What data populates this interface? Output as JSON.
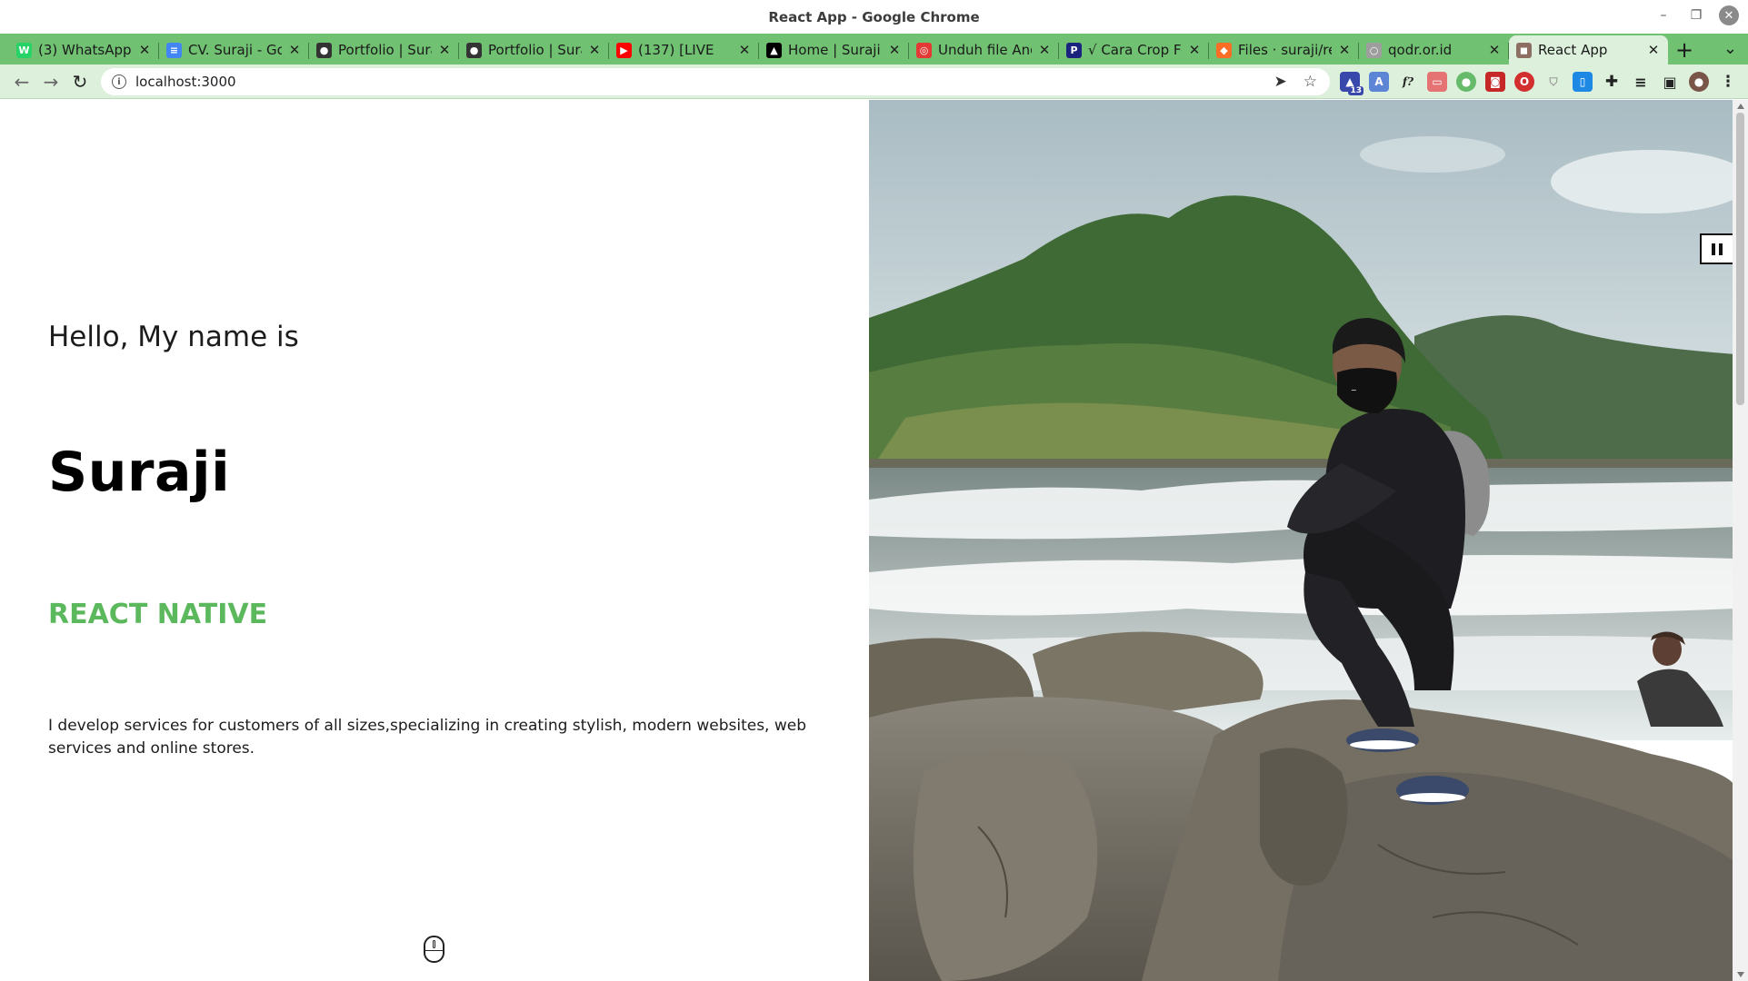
{
  "window": {
    "title": "React App - Google Chrome",
    "minimize_icon": "minimize-icon",
    "maximize_icon": "restore-icon",
    "close_icon": "close-icon"
  },
  "tabs": [
    {
      "label": "(3) WhatsApp",
      "icon": "whatsapp-icon",
      "color": "#25d366",
      "glyph": "W"
    },
    {
      "label": "CV. Suraji - Go",
      "icon": "google-docs-icon",
      "color": "#4285f4",
      "glyph": "≡"
    },
    {
      "label": "Portfolio | Sura",
      "icon": "github-icon",
      "color": "#333333",
      "glyph": "●"
    },
    {
      "label": "Portfolio | Sura",
      "icon": "github-icon",
      "color": "#333333",
      "glyph": "●"
    },
    {
      "label": "(137) [LIVE",
      "icon": "youtube-icon",
      "color": "#ff0000",
      "glyph": "▶"
    },
    {
      "label": "Home | Suraji |",
      "icon": "vercel-icon",
      "color": "#000000",
      "glyph": "▲"
    },
    {
      "label": "Unduh file And",
      "icon": "download-site-icon",
      "color": "#e53935",
      "glyph": "◎"
    },
    {
      "label": "√ Cara Crop Fo",
      "icon": "p-site-icon",
      "color": "#1a237e",
      "glyph": "P"
    },
    {
      "label": "Files · suraji/re",
      "icon": "gitlab-icon",
      "color": "#fc6d26",
      "glyph": "◆"
    },
    {
      "label": "qodr.or.id",
      "icon": "globe-icon",
      "color": "#9e9e9e",
      "glyph": "○"
    },
    {
      "label": "React App",
      "icon": "react-app-icon",
      "color": "#8d6e63",
      "glyph": "◼",
      "active": true
    }
  ],
  "toolbar": {
    "back_icon": "back-arrow-icon",
    "forward_icon": "forward-arrow-icon",
    "reload_icon": "reload-icon",
    "url": "localhost:3000",
    "site_info_icon": "info-icon",
    "send_icon": "send-icon",
    "bookmark_icon": "star-icon",
    "extension_badge": "13"
  },
  "colors": {
    "tab_strip": "#70c171",
    "active_tab": "#ddf0dc",
    "accent_green": "#5bb85c"
  },
  "hero": {
    "greeting": "Hello, My name is",
    "name": "Suraji",
    "role": "REACT NATIVE",
    "description": "I develop services for customers of all sizes,specializing in creating stylish, modern websites, web services and online stores.",
    "scroll_icon": "mouse-scroll-icon",
    "photo_alt": "Man wearing black mask crouching on rocks by the sea with green hills behind",
    "pause_icon": "pause-icon"
  }
}
